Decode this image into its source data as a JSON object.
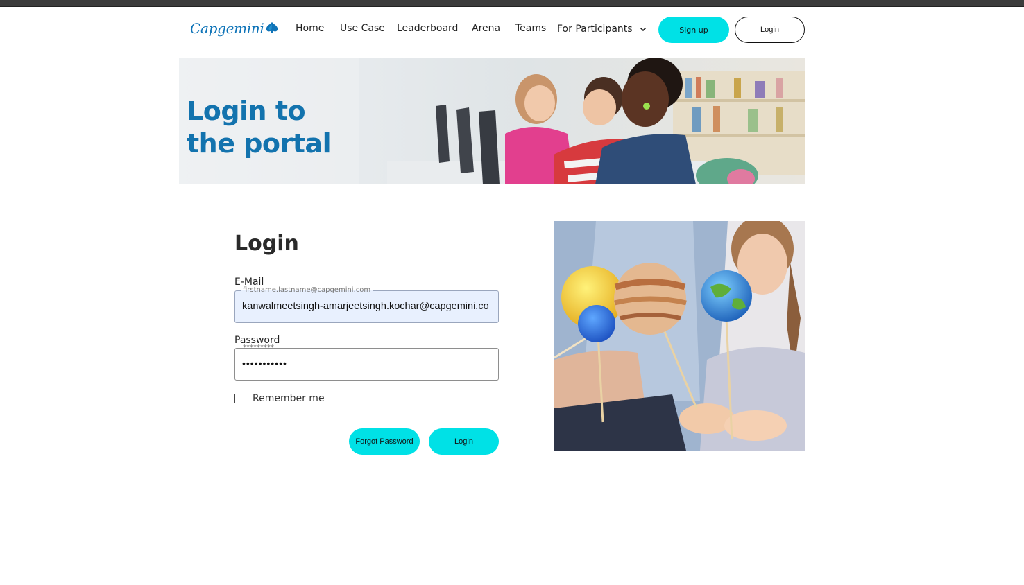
{
  "header": {
    "logo_text": "Capgemini",
    "nav": [
      "Home",
      "Use Case",
      "Leaderboard",
      "Arena",
      "Teams"
    ],
    "participants_label": "For Participants",
    "signup_label": "Sign up",
    "login_label": "Login",
    "accent_color": "#00e1e6",
    "brand_color": "#0f74b8"
  },
  "banner": {
    "title_line1": "Login to",
    "title_line2": "the portal"
  },
  "form": {
    "heading": "Login",
    "email_label": "E-Mail",
    "email_placeholder": "firstname.lastname@capgemini.com",
    "email_value": "kanwalmeetsingh-amarjeetsingh.kochar@capgemini.co",
    "password_label": "Password",
    "password_placeholder": "*********",
    "password_masked": "•••••••••••",
    "remember_label": "Remember me",
    "remember_checked": false,
    "forgot_label": "Forgot Password",
    "submit_label": "Login"
  }
}
